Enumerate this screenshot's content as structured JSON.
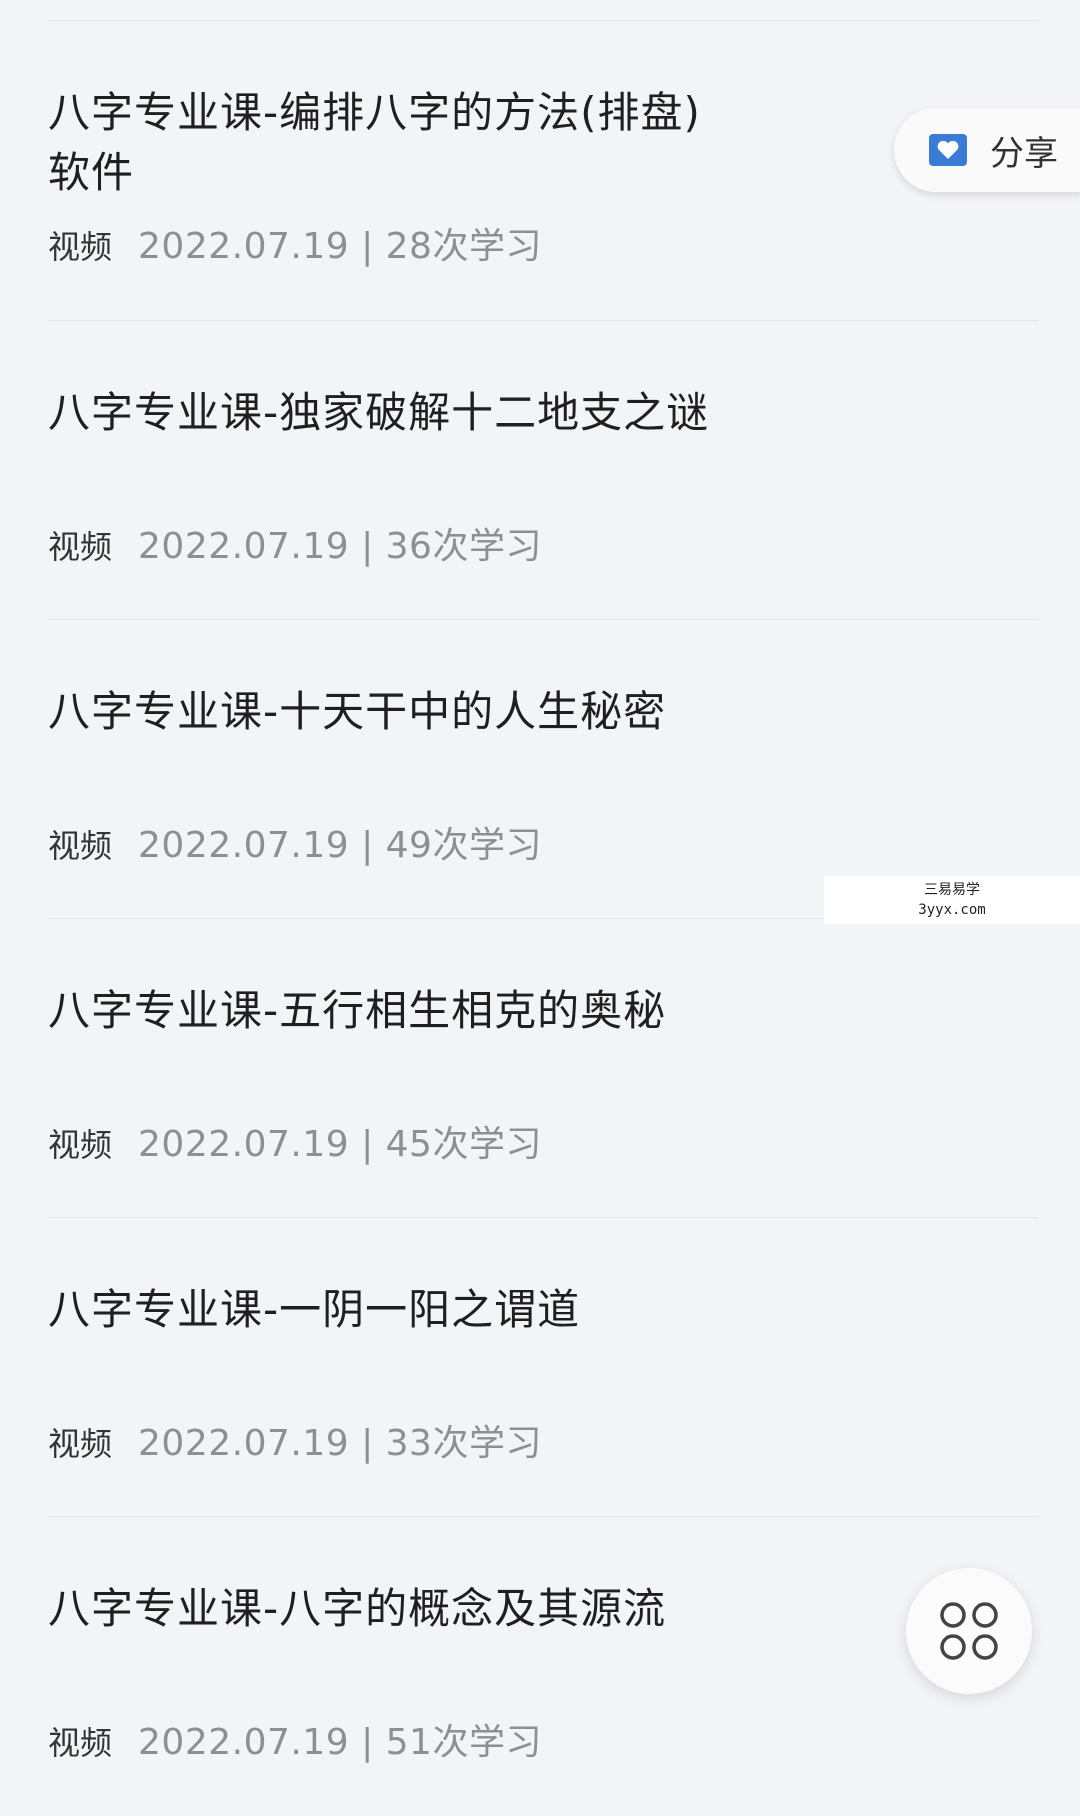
{
  "items": [
    {
      "title": "八字专业课-编排八字的方法(排盘)软件",
      "type": "视频",
      "info": "2022.07.19 | 28次学习"
    },
    {
      "title": "八字专业课-独家破解十二地支之谜",
      "type": "视频",
      "info": "2022.07.19 | 36次学习"
    },
    {
      "title": "八字专业课-十天干中的人生秘密",
      "type": "视频",
      "info": "2022.07.19 | 49次学习"
    },
    {
      "title": "八字专业课-五行相生相克的奥秘",
      "type": "视频",
      "info": "2022.07.19 | 45次学习"
    },
    {
      "title": "八字专业课-一阴一阳之谓道",
      "type": "视频",
      "info": "2022.07.19 | 33次学习"
    },
    {
      "title": "八字专业课-八字的概念及其源流",
      "type": "视频",
      "info": "2022.07.19 | 51次学习"
    }
  ],
  "share": {
    "label": "分享",
    "icon": "heart-envelope-icon"
  },
  "watermark": {
    "line1": "三易易学",
    "line2": "3yyx.com"
  },
  "fab": {
    "icon": "grid-menu-icon"
  },
  "colors": {
    "background": "#f3f4f7",
    "accent": "#3a7bd5",
    "meta": "#8d8f95"
  }
}
